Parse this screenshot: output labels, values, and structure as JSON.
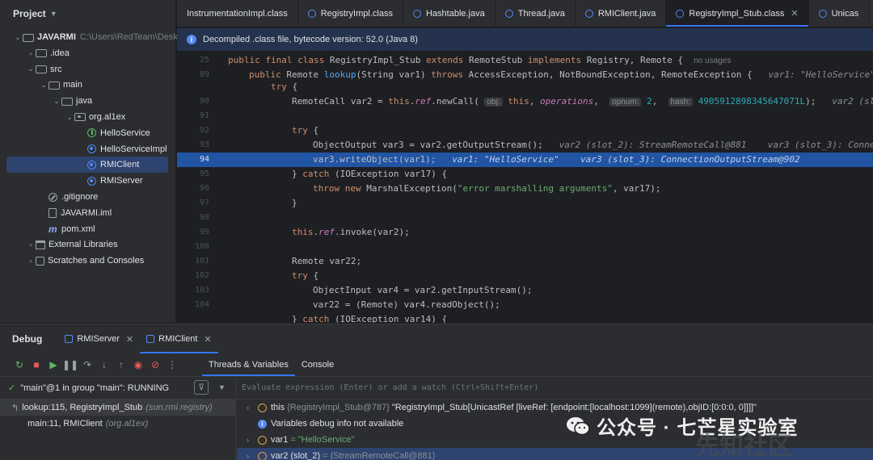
{
  "project": {
    "title": "Project",
    "tree": [
      {
        "label": "JAVARMI",
        "path": "C:\\Users\\RedTeam\\Desktop",
        "icon": "folder-icon",
        "indent": 0,
        "expanded": true
      },
      {
        "label": ".idea",
        "icon": "folder-icon",
        "indent": 1,
        "expanded": false
      },
      {
        "label": "src",
        "icon": "folder-icon",
        "indent": 1,
        "expanded": true
      },
      {
        "label": "main",
        "icon": "folder-icon",
        "indent": 2,
        "expanded": true
      },
      {
        "label": "java",
        "icon": "folder-icon",
        "indent": 3,
        "expanded": true
      },
      {
        "label": "org.al1ex",
        "icon": "package-icon",
        "indent": 4,
        "expanded": true
      },
      {
        "label": "HelloService",
        "icon": "interface-icon",
        "indent": 5
      },
      {
        "label": "HelloServiceImpl",
        "icon": "class-icon",
        "indent": 5
      },
      {
        "label": "RMIClient",
        "icon": "class-icon",
        "indent": 5,
        "selected": true
      },
      {
        "label": "RMIServer",
        "icon": "class-icon",
        "indent": 5
      },
      {
        "label": ".gitignore",
        "icon": "gitignore-icon",
        "indent": 2
      },
      {
        "label": "JAVARMI.iml",
        "icon": "file-icon",
        "indent": 2
      },
      {
        "label": "pom.xml",
        "icon": "maven-icon",
        "indent": 2
      },
      {
        "label": "External Libraries",
        "icon": "library-icon",
        "indent": 1,
        "expanded": false
      },
      {
        "label": "Scratches and Consoles",
        "icon": "scratch-icon",
        "indent": 1,
        "expanded": false
      }
    ]
  },
  "editor": {
    "tabs": [
      {
        "label": "InstrumentationImpl.class",
        "active": false
      },
      {
        "label": "RegistryImpl.class",
        "active": false
      },
      {
        "label": "Hashtable.java",
        "active": false
      },
      {
        "label": "Thread.java",
        "active": false
      },
      {
        "label": "RMIClient.java",
        "active": false
      },
      {
        "label": "RegistryImpl_Stub.class",
        "active": true
      },
      {
        "label": "Unicas",
        "active": false
      }
    ],
    "banner": "Decompiled .class file, bytecode version: 52.0 (Java 8)",
    "highlight_line": "94"
  },
  "debug": {
    "title": "Debug",
    "sessions": [
      {
        "label": "RMIServer",
        "active": false
      },
      {
        "label": "RMIClient",
        "active": true
      }
    ],
    "subtabs": [
      {
        "label": "Threads & Variables",
        "active": true
      },
      {
        "label": "Console",
        "active": false
      }
    ],
    "thread": "\"main\"@1 in group \"main\": RUNNING",
    "frames": [
      {
        "method": "lookup:115, RegistryImpl_Stub",
        "pkg": "(sun.rmi.registry)",
        "selected": true
      },
      {
        "method": "main:11, RMIClient",
        "pkg": "(org.al1ex)",
        "selected": false
      }
    ],
    "eval_placeholder": "Evaluate expression (Enter) or add a watch (Ctrl+Shift+Enter)",
    "variables": [
      {
        "name": "this",
        "type": "{RegistryImpl_Stub@787}",
        "value": "\"RegistryImpl_Stub[UnicastRef [liveRef: [endpoint:[localhost:1099](remote),objID:[0:0:0, 0]]]]\"",
        "icon": "field-icon"
      },
      {
        "name": "Variables debug info not available",
        "type": "",
        "value": "",
        "icon": "info-icon"
      },
      {
        "name": "var1",
        "type": "",
        "value": "= \"HelloService\"",
        "icon": "param-icon"
      },
      {
        "name": "var2 (slot_2)",
        "type": "= {StreamRemoteCall@881}",
        "value": "",
        "icon": "field-icon",
        "selected": true
      }
    ]
  },
  "watermark": {
    "text": "公众号 · 七芒星实验室",
    "site": "先知社区"
  }
}
